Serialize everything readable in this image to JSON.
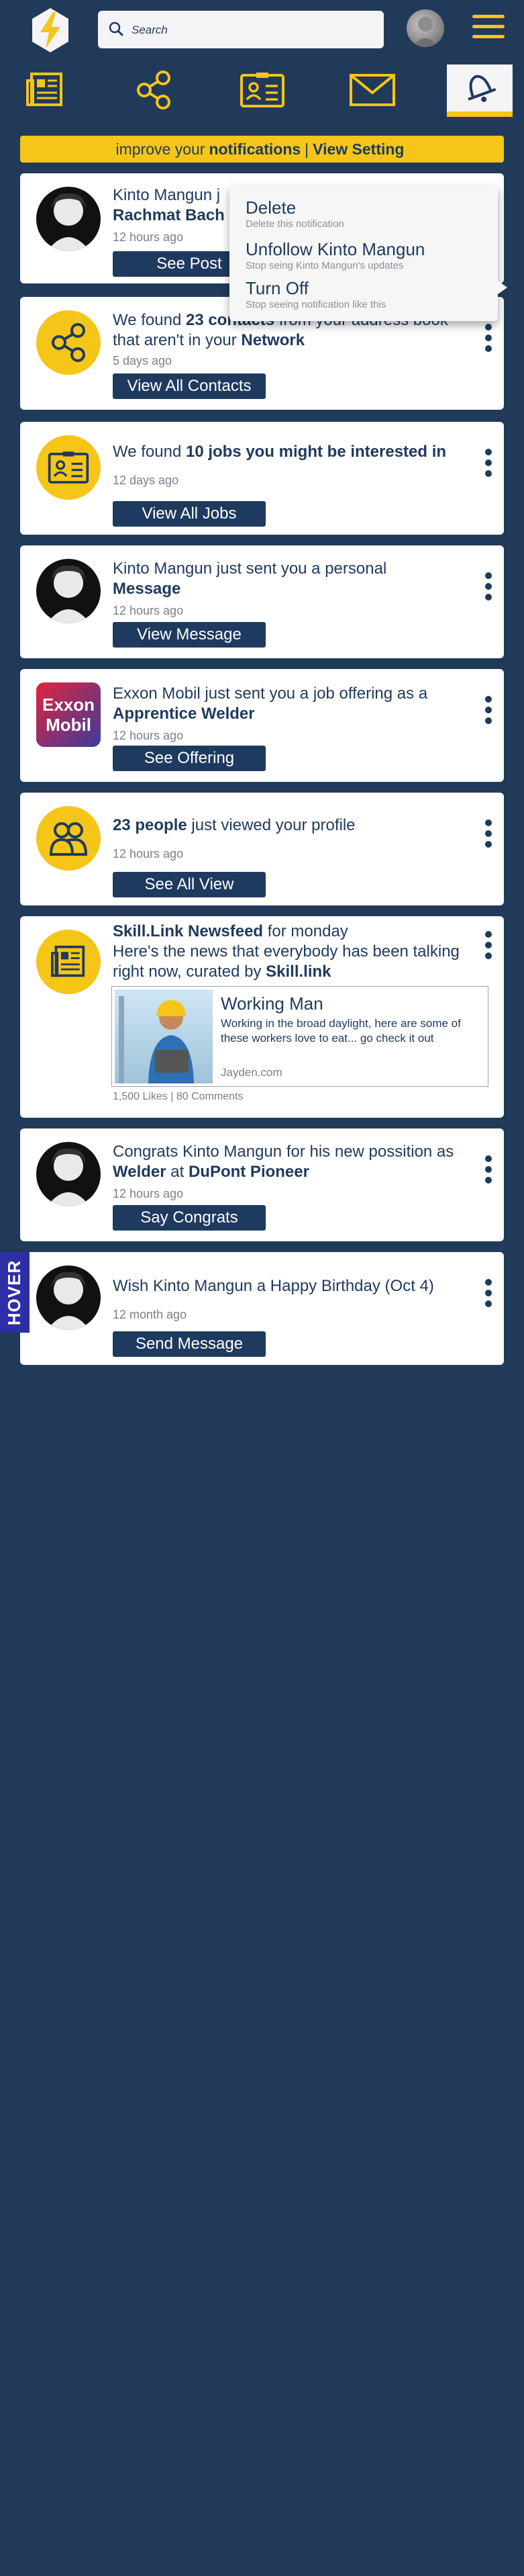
{
  "search": {
    "placeholder": "Search"
  },
  "banner": {
    "prefix": "improve your",
    "strong": "notifications",
    "separator": "|",
    "link": "View Setting"
  },
  "dropdown": {
    "options": [
      {
        "title": "Delete",
        "subtitle": "Delete this notification"
      },
      {
        "title": "Unfollow Kinto Mangun",
        "subtitle": "Stop seing Kinto Mangun's updates"
      },
      {
        "title": "Turn Off",
        "subtitle": "Stop seeing notification like this"
      }
    ]
  },
  "notifications": [
    {
      "line1": "Kinto Mangun j",
      "strong": "Rachmat Bach",
      "time": "12 hours ago",
      "button": "See Post"
    },
    {
      "pre": "We found",
      "strong1": "23 contacts",
      "mid": "from your address book that aren't in your",
      "strong2": "Network",
      "time": "5 days ago",
      "button": "View All Contacts"
    },
    {
      "pre": "We found",
      "strong": "10 jobs you might be interested in",
      "time": "12 days ago",
      "button": "View All Jobs"
    },
    {
      "pre": "Kinto Mangun just sent you a personal",
      "strong": "Message",
      "time": "12 hours ago",
      "button": "View Message"
    },
    {
      "pre": "Exxon Mobil just sent you a job offering as a",
      "strong": "Apprentice Welder",
      "time": "12 hours ago",
      "button": "See Offering",
      "logo_line1": "Exxon",
      "logo_line2": "Mobil"
    },
    {
      "strong": "23 people",
      "post": "just viewed your profile",
      "time": "12 hours ago",
      "button": "See All View"
    },
    {
      "strong": "Skill.Link Newsfeed",
      "post": "for monday",
      "line2": "Here's the news that everybody has been talking right now, curated by",
      "strong2": "Skill.link",
      "article": {
        "title": "Working Man",
        "desc": "Working in the broad daylight, here are some of these workers love to eat... go check it out",
        "domain": "Jayden.com"
      },
      "stats": "1,500 Likes | 80 Comments"
    },
    {
      "pre": "Congrats Kinto Mangun for his new possition as",
      "strong1": "Welder",
      "mid": "at",
      "strong2": "DuPont Pioneer",
      "time": "12 hours ago",
      "button": "Say Congrats"
    },
    {
      "pre": "Wish Kinto Mangun a Happy Birthday (Oct 4)",
      "time": "12 month ago",
      "button": "Send Message"
    }
  ],
  "hover_tag": "HOVER",
  "colors": {
    "navy": "#1f3a5f",
    "background": "#213a5a",
    "accent": "#f5c518",
    "hover_tag": "#2e2ea6"
  },
  "icons": [
    "logo-icon",
    "search-icon",
    "menu-icon",
    "newsfeed-icon",
    "network-icon",
    "jobs-icon",
    "messages-icon",
    "notifications-icon",
    "more-options-icon"
  ]
}
